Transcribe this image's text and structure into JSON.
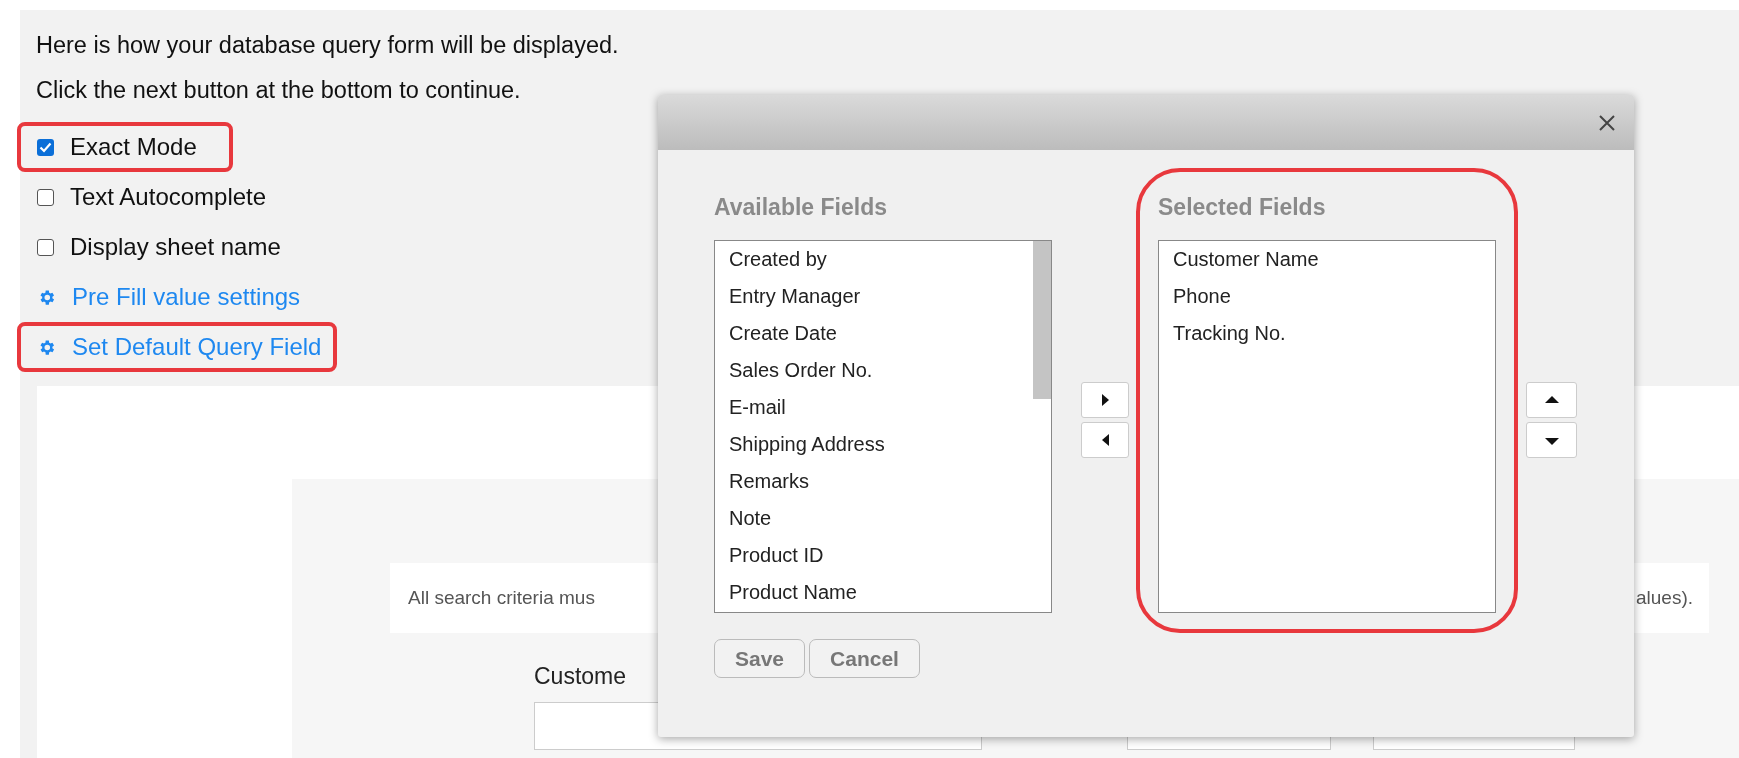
{
  "intro": [
    "Here is how your database query form will be displayed.",
    "Click the next button at the bottom to continue."
  ],
  "options": [
    {
      "label": "Exact Mode",
      "checked": true,
      "highlighted": true
    },
    {
      "label": "Text Autocomplete",
      "checked": false,
      "highlighted": false
    },
    {
      "label": "Display sheet name",
      "checked": false,
      "highlighted": false
    }
  ],
  "links": [
    {
      "label": "Pre Fill value settings",
      "highlighted": false
    },
    {
      "label": "Set Default Query Field",
      "highlighted": true
    }
  ],
  "preview": {
    "notice_start": "All search criteria mus",
    "notice_end": "alues).",
    "field_label": "Custome"
  },
  "dialog": {
    "available_title": "Available Fields",
    "available": [
      "Created by",
      "Entry Manager",
      "Create Date",
      "Sales Order No.",
      "E-mail",
      "Shipping Address",
      "Remarks",
      "Note",
      "Product ID",
      "Product Name"
    ],
    "selected_title": "Selected Fields",
    "selected": [
      "Customer Name",
      "Phone",
      "Tracking No."
    ],
    "selected_highlighted": true,
    "buttons": [
      "Save",
      "Cancel"
    ]
  }
}
